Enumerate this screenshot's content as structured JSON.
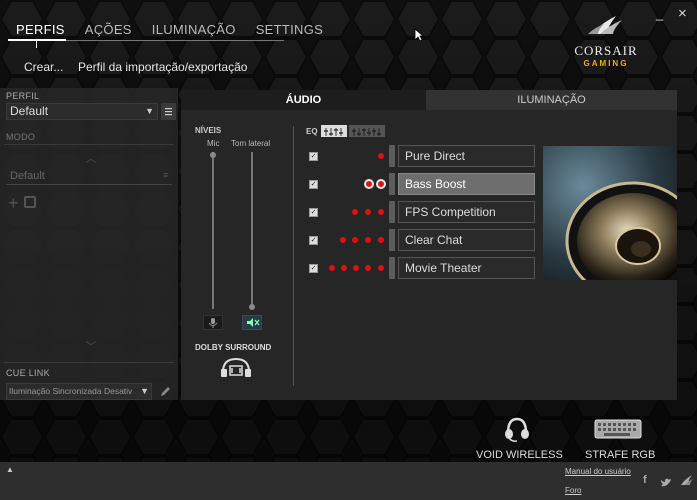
{
  "nav": {
    "tabs": [
      {
        "label": "PERFIS"
      },
      {
        "label": "AÇÕES"
      },
      {
        "label": "ILUMINAÇÃO"
      },
      {
        "label": "SETTINGS"
      }
    ],
    "subnav": {
      "create": "Crear...",
      "import_export": "Perfil da importação/exportação"
    }
  },
  "window": {
    "minimize": "_",
    "close": "×"
  },
  "logo": {
    "brand": "CORSAIR",
    "sub": "GAMING"
  },
  "left": {
    "profile_label": "PERFIL",
    "profile_value": "Default",
    "mode_label": "MODO",
    "mode_value": "Default",
    "cue_link_label": "CUE LINK",
    "cue_link_value": "Iluminação Sincronizada Desativ"
  },
  "tabs": {
    "audio": "ÁUDIO",
    "lighting": "ILUMINAÇÃO"
  },
  "levels": {
    "title": "NÍVEIS",
    "mic": "Mic",
    "sidetone": "Tom lateral",
    "dolby": "DOLBY SURROUND"
  },
  "eq": {
    "label": "EQ",
    "presets": [
      {
        "name": "Pure Direct",
        "dots": 1,
        "checked": true,
        "selected": false
      },
      {
        "name": "Bass Boost",
        "dots": 2,
        "checked": true,
        "selected": true
      },
      {
        "name": "FPS Competition",
        "dots": 3,
        "checked": true,
        "selected": false
      },
      {
        "name": "Clear Chat",
        "dots": 4,
        "checked": true,
        "selected": false
      },
      {
        "name": "Movie Theater",
        "dots": 5,
        "checked": true,
        "selected": false
      }
    ]
  },
  "devices": [
    {
      "name": "VOID WIRELESS",
      "icon": "headset-icon"
    },
    {
      "name": "STRAFE RGB",
      "icon": "keyboard-icon"
    }
  ],
  "footer": {
    "manual": "Manual do usuário",
    "forum": "Foro",
    "expand": "▲"
  },
  "colors": {
    "accent_red": "#e01010",
    "gold": "#e8b400"
  }
}
